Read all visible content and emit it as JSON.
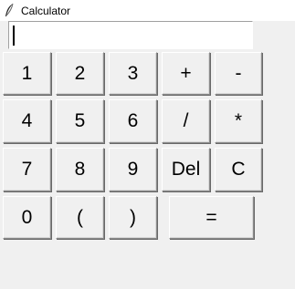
{
  "window": {
    "title": "Calculator",
    "icon": "feather-icon"
  },
  "entry": {
    "value": ""
  },
  "keypad": {
    "row1": [
      "1",
      "2",
      "3",
      "+",
      "-"
    ],
    "row2": [
      "4",
      "5",
      "6",
      "/",
      "*"
    ],
    "row3": [
      "7",
      "8",
      "9",
      "Del",
      "C"
    ],
    "row4": [
      "0",
      "(",
      ")",
      "="
    ]
  }
}
